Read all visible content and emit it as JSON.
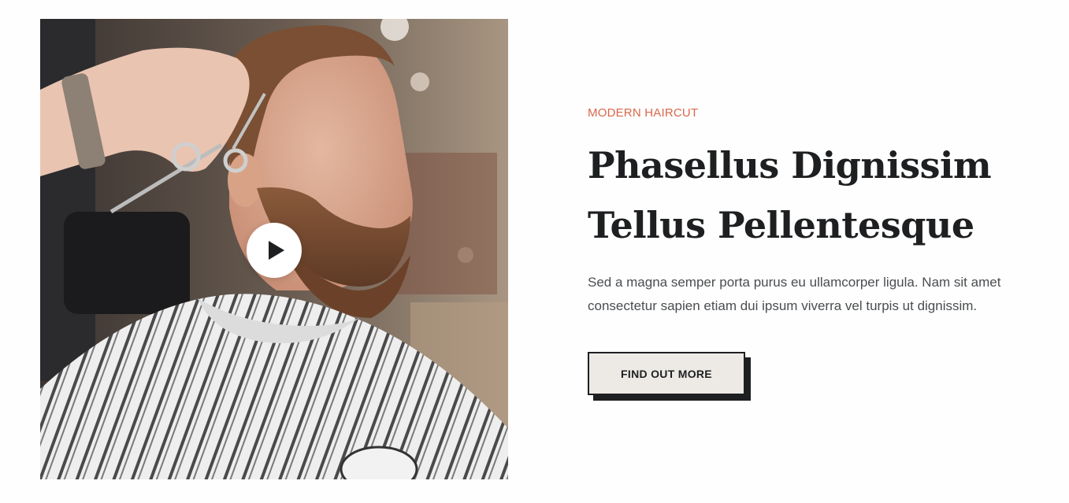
{
  "hero": {
    "eyebrow": "MODERN HAIRCUT",
    "headline_line1": "Phasellus Dignissim",
    "headline_line2": "Tellus Pellentesque",
    "body": "Sed a magna semper porta purus eu ullamcorper ligula. Nam sit amet consectetur sapien etiam dui ipsum viverra vel turpis ut dignissim.",
    "cta_label": "FIND OUT MORE"
  },
  "media": {
    "play_icon": "play-icon",
    "image_subject": "barber-photo"
  },
  "colors": {
    "accent": "#d9674a",
    "heading": "#1d1f21",
    "body": "#4a4d50",
    "button_bg": "#ede9e5",
    "button_border": "#1d1f21"
  }
}
